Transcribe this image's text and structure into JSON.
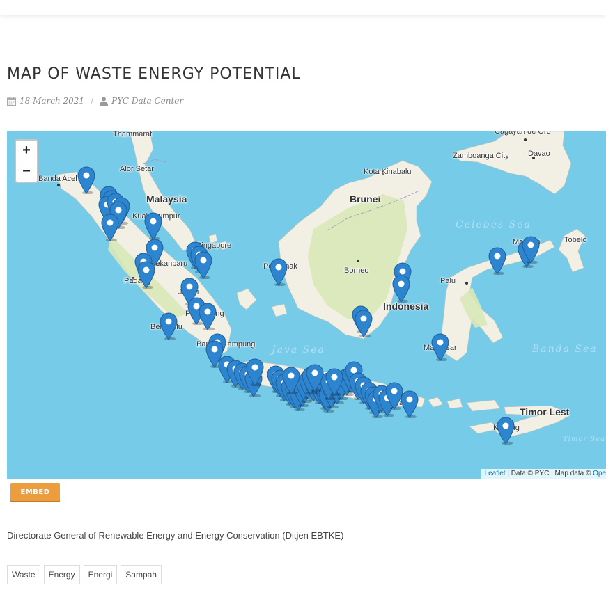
{
  "page": {
    "title": "MAP OF WASTE ENERGY POTENTIAL",
    "date": "18 March 2021",
    "author": "PYC Data Center"
  },
  "map": {
    "zoom_in": "+",
    "zoom_out": "−",
    "attribution": {
      "leaflet": "Leaflet",
      "rest": " | Data © PYC | Map data © ",
      "osm": "Ope"
    },
    "colors": {
      "water": "#76cbe9",
      "land": "#f2efe4",
      "forest": "#d8e8b8",
      "marker": "#2e85cf"
    },
    "places": [
      {
        "name": "Thammarat",
        "kind": "city"
      },
      {
        "name": "Banda Aceh",
        "kind": "city"
      },
      {
        "name": "Alor Setar",
        "kind": "city"
      },
      {
        "name": "Malaysia",
        "kind": "country"
      },
      {
        "name": "Kuala Lumpur",
        "kind": "city"
      },
      {
        "name": "Singapore",
        "kind": "city"
      },
      {
        "name": "Pekanbaru",
        "kind": "city"
      },
      {
        "name": "Padang",
        "kind": "city"
      },
      {
        "name": "Jambi",
        "kind": "city"
      },
      {
        "name": "Palembang",
        "kind": "city"
      },
      {
        "name": "Bengkulu",
        "kind": "city"
      },
      {
        "name": "Bandar Lampung",
        "kind": "city"
      },
      {
        "name": "Kota Kinabalu",
        "kind": "city"
      },
      {
        "name": "Brunei",
        "kind": "country"
      },
      {
        "name": "Pontianak",
        "kind": "city"
      },
      {
        "name": "Borneo",
        "kind": "city"
      },
      {
        "name": "Indonesia",
        "kind": "country"
      },
      {
        "name": "Zamboanga City",
        "kind": "city"
      },
      {
        "name": "Cagayan de Oro",
        "kind": "city"
      },
      {
        "name": "Davao",
        "kind": "city"
      },
      {
        "name": "Manado",
        "kind": "city"
      },
      {
        "name": "Tobelo",
        "kind": "city"
      },
      {
        "name": "Palu",
        "kind": "city"
      },
      {
        "name": "Makassar",
        "kind": "city"
      },
      {
        "name": "Surabaya",
        "kind": "city"
      },
      {
        "name": "Timor Lest",
        "kind": "country"
      },
      {
        "name": "Kupang",
        "kind": "city"
      },
      {
        "name": "Java Sea",
        "kind": "sea"
      },
      {
        "name": "Celebes Sea",
        "kind": "sea"
      },
      {
        "name": "Banda Sea",
        "kind": "sea"
      },
      {
        "name": "Timor Sea",
        "kind": "sea"
      }
    ]
  },
  "embed_label": "EMBED",
  "description": "Directorate General of Renewable Energy and Energy Conservation (Ditjen EBTKE)",
  "tags": [
    "Waste",
    "Energy",
    "Energi",
    "Sampah"
  ]
}
